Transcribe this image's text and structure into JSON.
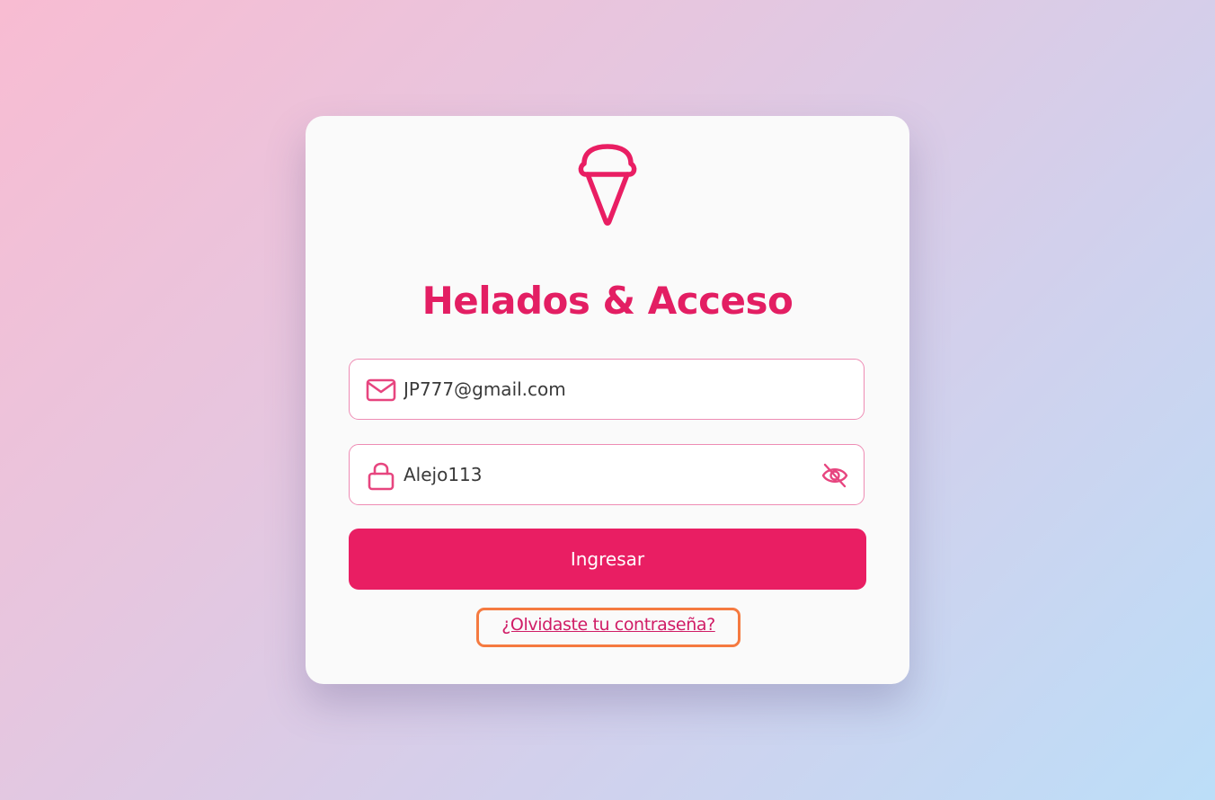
{
  "app": {
    "title": "Helados & Acceso",
    "accent_color": "#e91e63",
    "logo_icon": "ice-cream-icon"
  },
  "form": {
    "email": {
      "value": "JP777@gmail.com",
      "icon": "mail-icon"
    },
    "password": {
      "value": "Alejo113",
      "icon": "lock-icon",
      "toggle_icon": "eye-off-icon"
    },
    "submit_label": "Ingresar",
    "forgot_label": "¿Olvidaste tu contraseña?"
  }
}
